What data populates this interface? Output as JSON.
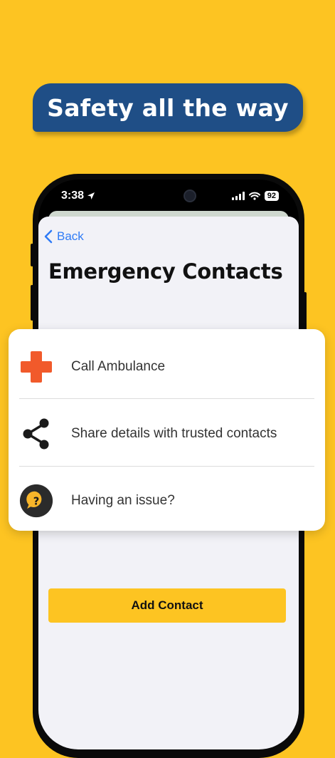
{
  "banner": {
    "text": "Safety all the way"
  },
  "status_bar": {
    "time": "3:38",
    "battery": "92"
  },
  "nav": {
    "back_label": "Back"
  },
  "page": {
    "title": "Emergency Contacts"
  },
  "options": [
    {
      "label": "Call Ambulance",
      "icon": "medical-cross-icon"
    },
    {
      "label": "Share details with trusted contacts",
      "icon": "share-icon"
    },
    {
      "label": "Having an issue?",
      "icon": "help-icon"
    }
  ],
  "actions": {
    "add_contact_label": "Add Contact"
  },
  "colors": {
    "background": "#FDC422",
    "banner": "#1F4E86",
    "accent_blue": "#2F7BF6",
    "medical_cross": "#F15A2B",
    "help_icon": "#F8B52A",
    "button": "#FDC422"
  }
}
